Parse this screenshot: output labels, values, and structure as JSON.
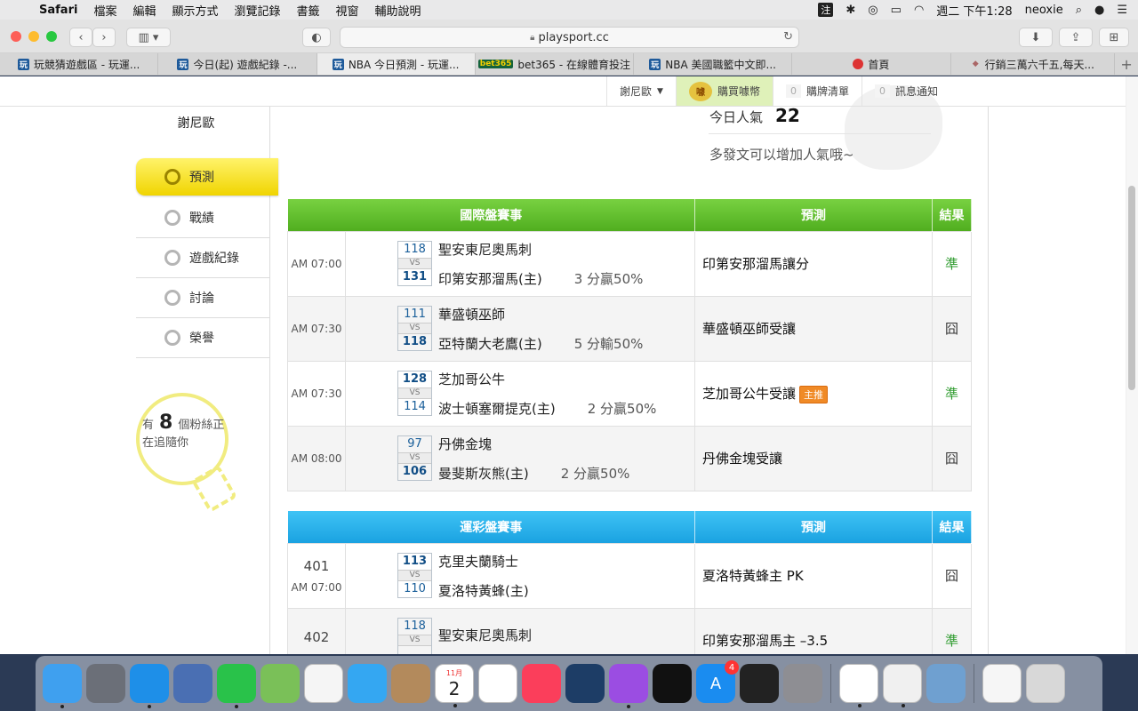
{
  "menubar": {
    "app": "Safari",
    "items": [
      "檔案",
      "編輯",
      "顯示方式",
      "瀏覽記錄",
      "書籤",
      "視窗",
      "輔助說明"
    ],
    "input_indicator": "注",
    "clock": "週二 下午1:28",
    "user": "neoxie"
  },
  "browser": {
    "url": "playsport.cc",
    "tabs": [
      {
        "icon": "玩",
        "title": "玩競猜遊戲區 - 玩運..."
      },
      {
        "icon": "玩",
        "title": "今日(起) 遊戲紀錄 -..."
      },
      {
        "icon": "玩",
        "title": "NBA 今日預測 - 玩運...",
        "active": true
      },
      {
        "icon": "bet365",
        "title": "bet365 - 在線體育投注"
      },
      {
        "icon": "玩",
        "title": "NBA 美國職籃中文即..."
      },
      {
        "icon": "",
        "title": "首頁"
      },
      {
        "icon": "",
        "title": "行銷三萬六千五,每天..."
      }
    ],
    "new_tab": "+"
  },
  "topnav": {
    "user_menu": "謝尼歐",
    "buy_coin": "購買噱幣",
    "coin_icon": "噱",
    "cart_count": "0",
    "cart_label": "購牌清單",
    "notify_count": "0",
    "notify_label": "訊息通知"
  },
  "sidebar": {
    "username": "謝尼歐",
    "items": [
      {
        "label": "預測",
        "icon": "target-icon",
        "active": true
      },
      {
        "label": "戰績",
        "icon": "record-icon"
      },
      {
        "label": "遊戲紀錄",
        "icon": "circle-icon"
      },
      {
        "label": "討論",
        "icon": "discuss-icon"
      },
      {
        "label": "榮譽",
        "icon": "medal-icon"
      }
    ],
    "fans_prefix": "有",
    "fans_count": "8",
    "fans_suffix": "個粉絲正",
    "fans_line2": "在追隨你"
  },
  "popularity": {
    "label": "今日人氣",
    "value": "22",
    "hint": "多發文可以增加人氣哦~"
  },
  "intl_table": {
    "headers": [
      "國際盤賽事",
      "預測",
      "結果"
    ],
    "rows": [
      {
        "time": "AM 07:00",
        "score1": "118",
        "score2": "131",
        "team1": "聖安東尼奧馬刺",
        "team2": "印第安那溜馬(主)",
        "spread": "3 分贏50%",
        "pick": "印第安那溜馬",
        "pick_type": "讓分",
        "badge": "",
        "result": "準",
        "winner": 2
      },
      {
        "time": "AM 07:30",
        "score1": "111",
        "score2": "118",
        "team1": "華盛頓巫師",
        "team2": "亞特蘭大老鷹(主)",
        "spread": "5 分輸50%",
        "pick": "華盛頓巫師",
        "pick_type": "受讓",
        "badge": "",
        "result": "囧",
        "winner": 2
      },
      {
        "time": "AM 07:30",
        "score1": "128",
        "score2": "114",
        "team1": "芝加哥公牛",
        "team2": "波士頓塞爾提克(主)",
        "spread": "2 分贏50%",
        "pick": "芝加哥公牛",
        "pick_type": "受讓",
        "badge": "主推",
        "result": "準",
        "winner": 1
      },
      {
        "time": "AM 08:00",
        "score1": "97",
        "score2": "106",
        "team1": "丹佛金塊",
        "team2": "曼斐斯灰熊(主)",
        "spread": "2 分贏50%",
        "pick": "丹佛金塊",
        "pick_type": "受讓",
        "badge": "",
        "result": "囧",
        "winner": 2
      }
    ]
  },
  "lottery_table": {
    "headers": [
      "運彩盤賽事",
      "預測",
      "結果"
    ],
    "rows": [
      {
        "no": "401",
        "time": "AM 07:00",
        "score1": "113",
        "score2": "110",
        "team1": "克里夫蘭騎士",
        "team2": "夏洛特黃蜂(主)",
        "pick": "夏洛特黃蜂",
        "pick_type": "主 PK",
        "result": "囧",
        "winner": 1
      },
      {
        "no": "402",
        "time": "",
        "score1": "118",
        "score2": "",
        "team1": "聖安東尼奧馬刺",
        "team2": "",
        "pick": "印第安那溜馬",
        "pick_type": "主 –3.5",
        "result": "準",
        "winner": 0
      }
    ]
  },
  "dock": {
    "calendar_month": "11月",
    "calendar_day": "2",
    "appstore_badge": "4",
    "items": [
      "finder-icon",
      "launchpad-icon",
      "safari-icon",
      "preview-icon",
      "facetime-icon",
      "maps-icon",
      "photos-icon",
      "messages-icon",
      "contacts-icon",
      "calendar-icon",
      "reminders-icon",
      "music-icon",
      "quicktime-icon",
      "podcasts-icon",
      "tv-icon",
      "appstore-icon",
      "voice-memos-icon",
      "system-preferences-icon",
      "chrome-icon",
      "textedit-icon",
      "preview-photos-icon",
      "documents-icon",
      "trash-icon"
    ]
  },
  "colors": {
    "green_header": "#5cb82a",
    "blue_header": "#26aee8",
    "hit": "#2d9b2d",
    "active_menu": "#f5dc1f"
  }
}
